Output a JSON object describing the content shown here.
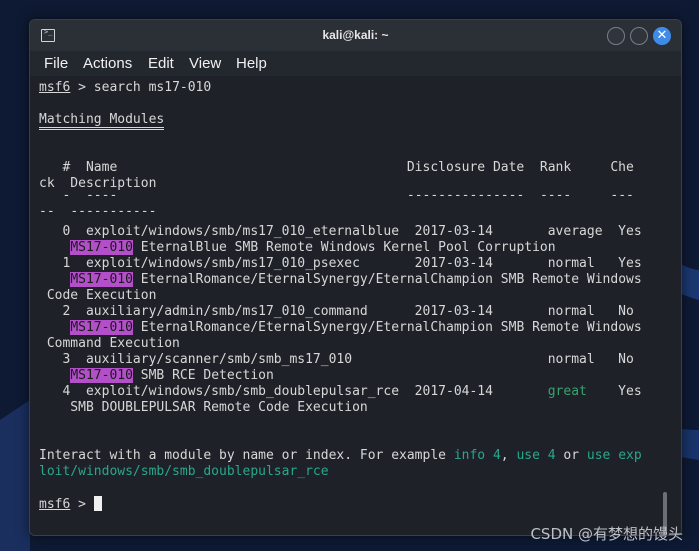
{
  "window": {
    "title": "kali@kali: ~",
    "close_glyph": "✕"
  },
  "menu": [
    "File",
    "Actions",
    "Edit",
    "View",
    "Help"
  ],
  "terminal": {
    "prompt": "msf6",
    "prompt_sep": " > ",
    "command": "search ms17-010",
    "section_title": "Matching Modules",
    "header_line1": "   #  Name                                     Disclosure Date  Rank     Che",
    "header_line2": "ck  Description",
    "rule_pre": "   ",
    "rule_hash": "-",
    "rule_name": "----",
    "rule_date": "---------------",
    "rule_rank": "----",
    "rule_che": "---",
    "rule2_pre": "--",
    "rule_desc": "-----------",
    "modules": [
      {
        "row": "   0  exploit/windows/smb/ms17_010_eternalblue  2017-03-14       average  Yes",
        "desc_indent": "    ",
        "desc_hl": "MS17-010",
        "desc_rest": " EternalBlue SMB Remote Windows Kernel Pool Corruption",
        "wrap": ""
      },
      {
        "row": "   1  exploit/windows/smb/ms17_010_psexec       2017-03-14       normal   Yes",
        "desc_indent": "    ",
        "desc_hl": "MS17-010",
        "desc_rest": " EternalRomance/EternalSynergy/EternalChampion SMB Remote Windows",
        "wrap": " Code Execution"
      },
      {
        "row": "   2  auxiliary/admin/smb/ms17_010_command      2017-03-14       normal   No",
        "desc_indent": "    ",
        "desc_hl": "MS17-010",
        "desc_rest": " EternalRomance/EternalSynergy/EternalChampion SMB Remote Windows",
        "wrap": " Command Execution"
      },
      {
        "row": "   3  auxiliary/scanner/smb/smb_ms17_010                         normal   No",
        "desc_indent": "    ",
        "desc_hl": "MS17-010",
        "desc_rest": " SMB RCE Detection",
        "wrap": ""
      },
      {
        "row_pre": "   4  exploit/windows/smb/smb_doublepulsar_rce  2017-04-14       ",
        "row_rank": "great",
        "row_post": "    Yes",
        "desc_plain": "    SMB DOUBLEPULSAR Remote Code Execution"
      }
    ],
    "interact": {
      "text1": "Interact with a module by name or index. For example ",
      "link1": "info 4",
      "sep1": ", ",
      "link2": "use 4",
      "sep2": " or ",
      "link3": "use exp",
      "link3_cont": "loit/windows/smb/smb_doublepulsar_rce"
    },
    "final_prompt": "msf6",
    "final_sep": " > "
  },
  "watermark": "CSDN @有梦想的馒头",
  "colors": {
    "highlight": "#b24fc9",
    "green": "#37a36d",
    "cyan": "#28a78a",
    "close_button": "#3e8ce8"
  }
}
